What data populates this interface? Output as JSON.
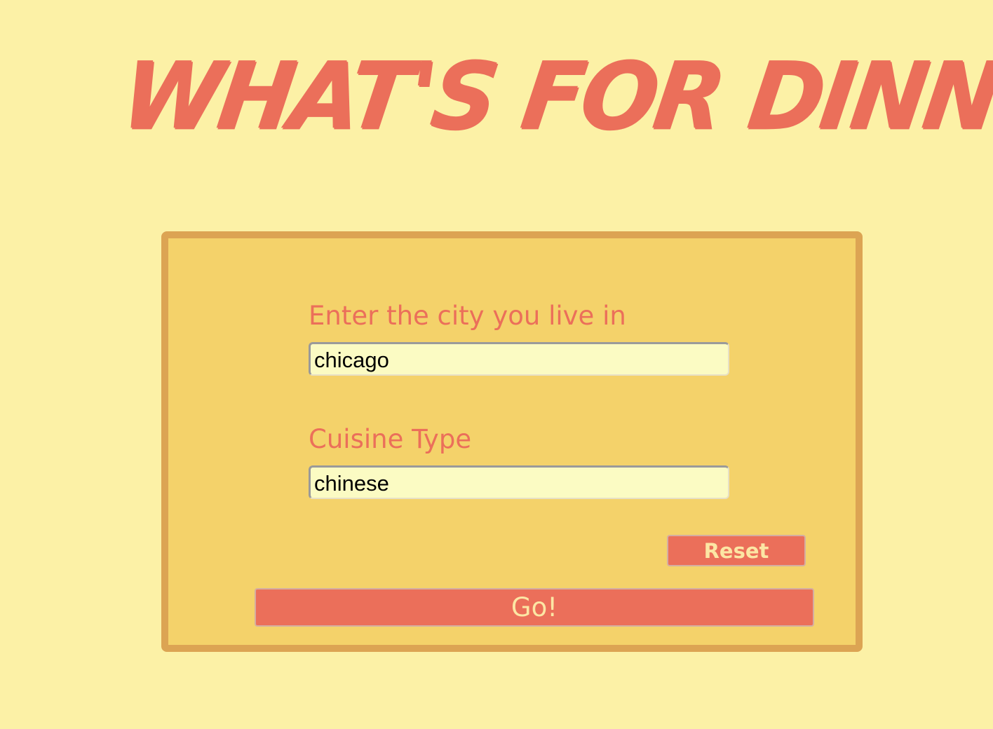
{
  "page": {
    "title": "WHAT'S FOR DINNER?"
  },
  "form": {
    "city_label": "Enter the city you live in",
    "city_value": "chicago",
    "cuisine_label": "Cuisine Type",
    "cuisine_value": "chinese",
    "reset_label": "Reset",
    "go_label": "Go!"
  },
  "colors": {
    "background": "#fcf1a6",
    "panel": "#f4d26a",
    "panel_border": "#dca453",
    "accent": "#eb6f5a",
    "input_background": "#fbfbc3",
    "button_text": "#fce6a4"
  }
}
